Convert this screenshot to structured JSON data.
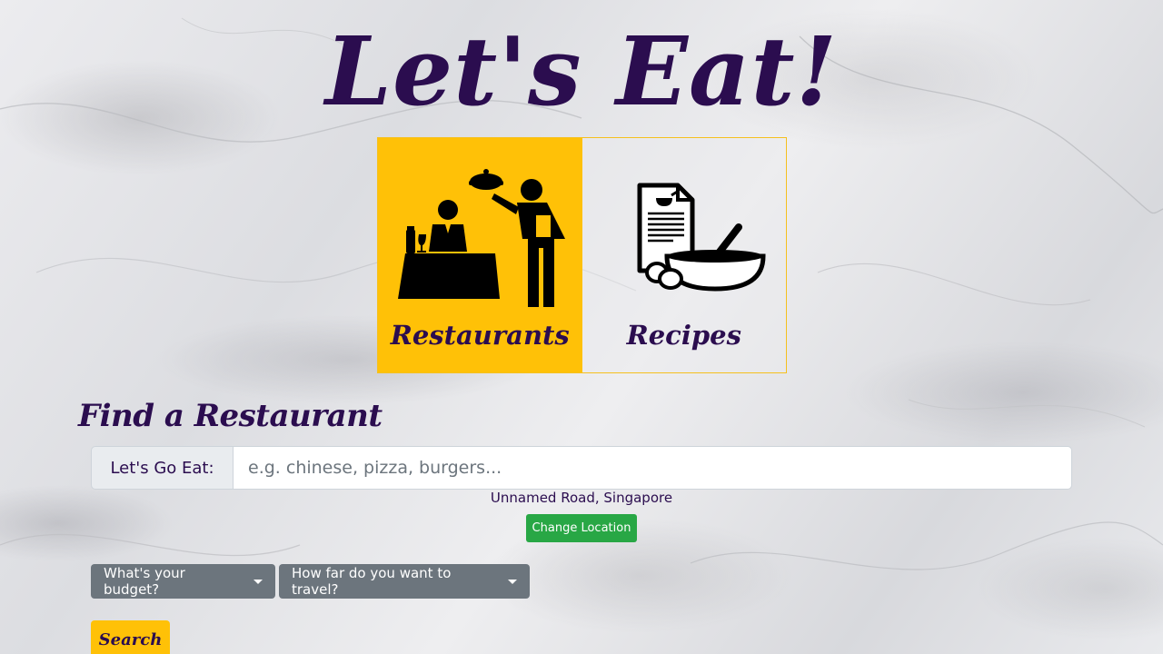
{
  "app": {
    "title": "Let's Eat!"
  },
  "categories": {
    "restaurants_label": "Restaurants",
    "recipes_label": "Recipes",
    "active": "restaurants",
    "active_color": "#ffc107"
  },
  "finder": {
    "heading": "Find a Restaurant",
    "input_label": "Let's Go Eat:",
    "input_value": "",
    "input_placeholder": "e.g. chinese, pizza, burgers...",
    "location": "Unnamed Road, Singapore",
    "change_location_label": "Change Location",
    "budget_label": "What's your budget?",
    "distance_label": "How far do you want to travel?",
    "search_label": "Search"
  },
  "icons": {
    "restaurants": "restaurant-waiter-icon",
    "recipes": "recipe-bowl-icon",
    "dropdown": "caret-down-icon"
  },
  "colors": {
    "brand_text": "#2b0d4f",
    "accent": "#ffc107",
    "success": "#28a745",
    "secondary": "#6c757d"
  }
}
